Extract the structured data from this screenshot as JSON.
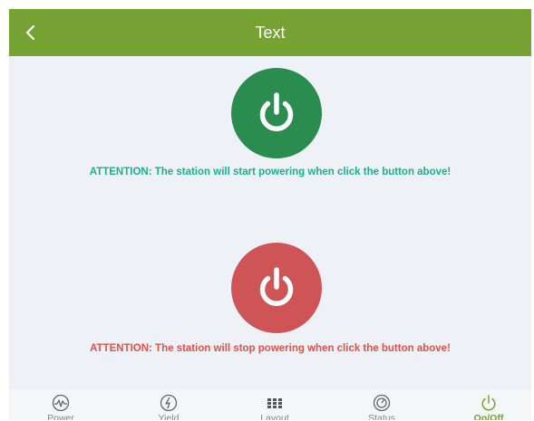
{
  "header": {
    "title": "Text",
    "back_icon": "chevron-left-icon"
  },
  "start": {
    "button_icon": "power-icon",
    "color": "#2a8c4f",
    "notice": "ATTENTION: The station will start powering when click the button above!",
    "notice_color": "#1cb08f"
  },
  "stop": {
    "button_icon": "power-icon",
    "color": "#cf5456",
    "notice": "ATTENTION: The station will stop powering when click the button above!",
    "notice_color": "#e0524a"
  },
  "tabs": [
    {
      "label": "Power",
      "icon": "power-wave-icon",
      "active": false
    },
    {
      "label": "Yield",
      "icon": "lightning-icon",
      "active": false
    },
    {
      "label": "Layout",
      "icon": "grid-icon",
      "active": false
    },
    {
      "label": "Status",
      "icon": "gauge-icon",
      "active": false
    },
    {
      "label": "On/Off",
      "icon": "power-icon",
      "active": true
    }
  ],
  "colors": {
    "header": "#76a233",
    "background": "#eef1f5",
    "active_tab": "#76a233"
  }
}
